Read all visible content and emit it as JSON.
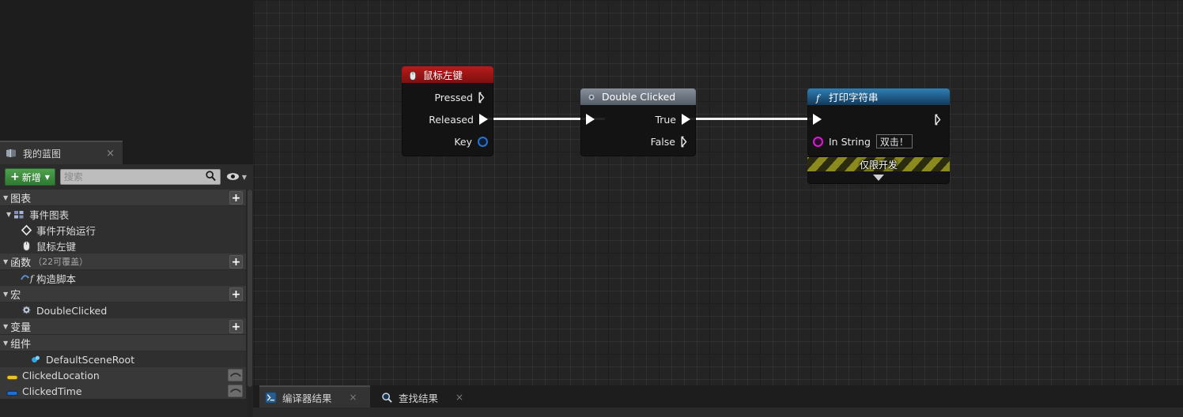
{
  "panel": {
    "tab": {
      "label": "我的蓝图",
      "icon": "blueprint-book-icon",
      "close": "×"
    },
    "toolbar": {
      "add_label": "新增",
      "add_plus": "+",
      "caret": "▼",
      "search_placeholder": "搜索",
      "search_value": "",
      "search_icon": "magnifier-icon",
      "eye_icon": "eye-icon"
    },
    "sections": [
      {
        "id": "graphs",
        "title": "图表",
        "note": "",
        "plus": "+",
        "rows": [
          {
            "label": "事件图表",
            "icon": "event-graph-icon",
            "indent": 1,
            "expander": "◢"
          },
          {
            "label": "事件开始运行",
            "icon": "event-diamond-icon",
            "indent": 2,
            "expander": ""
          },
          {
            "label": "鼠标左键",
            "icon": "mouse-icon",
            "indent": 2,
            "expander": ""
          }
        ]
      },
      {
        "id": "functions",
        "title": "函数",
        "note": "（22可覆盖）",
        "plus": "+",
        "rows": [
          {
            "label": "构造脚本",
            "icon": "construction-script-icon",
            "indent": 2,
            "expander": ""
          }
        ]
      },
      {
        "id": "macros",
        "title": "宏",
        "note": "",
        "plus": "+",
        "rows": [
          {
            "label": "DoubleClicked",
            "icon": "macro-gear-icon",
            "indent": 2,
            "expander": ""
          }
        ]
      },
      {
        "id": "variables",
        "title": "变量",
        "note": "",
        "plus": "+",
        "rows": []
      },
      {
        "id": "components",
        "title": "组件",
        "note": "",
        "plus": "",
        "rows": [
          {
            "label": "DefaultSceneRoot",
            "icon": "scene-root-icon",
            "indent": 3,
            "expander": "",
            "eye": false
          },
          {
            "label": "ClickedLocation",
            "icon": "vector-pill-icon",
            "indent": 1,
            "expander": "",
            "eye": true
          },
          {
            "label": "ClickedTime",
            "icon": "float-pill-icon",
            "indent": 1,
            "expander": "",
            "eye": true
          }
        ]
      }
    ]
  },
  "graph": {
    "nodes": [
      {
        "id": "mouse-left-button",
        "title": "鼠标左键",
        "icon": "mouse-icon",
        "header_color": "#a01414",
        "pins_out": [
          {
            "label": "Pressed",
            "type": "exec",
            "connected": false
          },
          {
            "label": "Released",
            "type": "exec",
            "connected": true
          },
          {
            "label": "Key",
            "type": "data",
            "color": "#2a72d0"
          }
        ]
      },
      {
        "id": "double-clicked",
        "title": "Double Clicked",
        "icon": "macro-gear-icon",
        "header_color": "#6d7682",
        "pins_in": [
          {
            "label": "",
            "type": "exec",
            "connected": true
          }
        ],
        "pins_out": [
          {
            "label": "True",
            "type": "exec",
            "connected": true
          },
          {
            "label": "False",
            "type": "exec",
            "connected": false
          }
        ]
      },
      {
        "id": "print-string",
        "title": "打印字符串",
        "icon": "function-f-icon",
        "header_color": "#1d5f8f",
        "pins_in": [
          {
            "label": "",
            "type": "exec",
            "connected": true
          },
          {
            "label": "In String",
            "type": "data",
            "color": "#e018d8",
            "value": "双击！"
          }
        ],
        "pins_out": [
          {
            "label": "",
            "type": "exec",
            "connected": false
          }
        ],
        "banner": "仅限开发",
        "expander": "▼"
      }
    ]
  },
  "dock": {
    "tabs": [
      {
        "label": "编译器结果",
        "icon": "compiler-results-icon",
        "close": "×",
        "active": true
      },
      {
        "label": "查找结果",
        "icon": "find-results-icon",
        "close": "×",
        "active": false
      }
    ],
    "status_line": ""
  }
}
